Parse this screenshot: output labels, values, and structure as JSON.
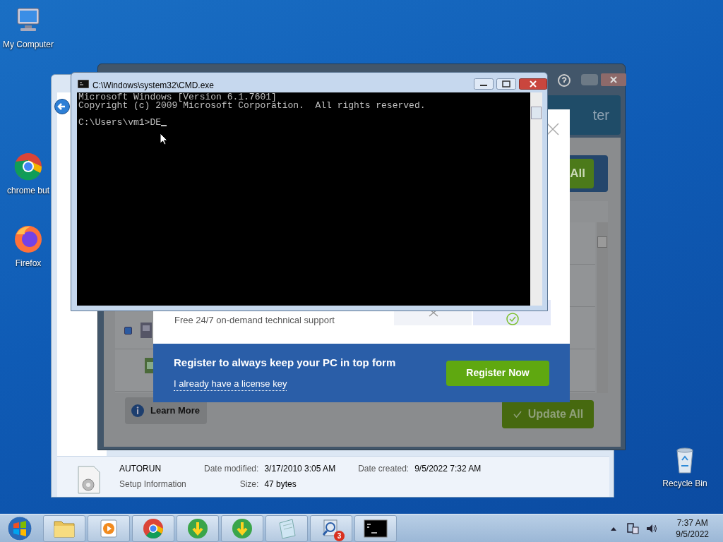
{
  "desktop_icons": [
    {
      "label": "My Computer",
      "kind": "computer"
    },
    {
      "label": "chrome but",
      "kind": "chrome"
    },
    {
      "label": "Firefox",
      "kind": "firefox"
    },
    {
      "label": "Recycle Bin",
      "kind": "bin"
    }
  ],
  "explorer": {
    "file_name": "AUTORUN",
    "file_type": "Setup Information",
    "fields": [
      {
        "label": "Date modified:",
        "value": "3/17/2010 3:05 AM"
      },
      {
        "label": "Date created:",
        "value": "9/5/2022 7:32 AM"
      },
      {
        "label": "Size:",
        "value": "47 bytes"
      }
    ]
  },
  "updater": {
    "header_fragment": "ter",
    "top_button_fragment": "All",
    "row_checked": true,
    "learn_more": "Learn More",
    "update_all": "Update All"
  },
  "modal": {
    "feature": "Free 24/7 on-demand technical support",
    "headline": "Register to always keep your PC in top form",
    "license_link": "I already have a license key",
    "register_button": "Register Now"
  },
  "console": {
    "title": "C:\\Windows\\system32\\CMD.exe",
    "lines": [
      "Microsoft Windows [Version 6.1.7601]",
      "Copyright (c) 2009 Microsoft Corporation.  All rights reserved."
    ],
    "prompt": "C:\\Users\\vm1>DE"
  },
  "taskbar": {
    "buttons": [
      {
        "kind": "folder"
      },
      {
        "kind": "media"
      },
      {
        "kind": "chrome"
      },
      {
        "kind": "download"
      },
      {
        "kind": "download"
      },
      {
        "kind": "notepad"
      },
      {
        "kind": "scanner",
        "badge": "3"
      },
      {
        "kind": "console"
      }
    ],
    "time": "7:37 AM",
    "date": "9/5/2022"
  }
}
